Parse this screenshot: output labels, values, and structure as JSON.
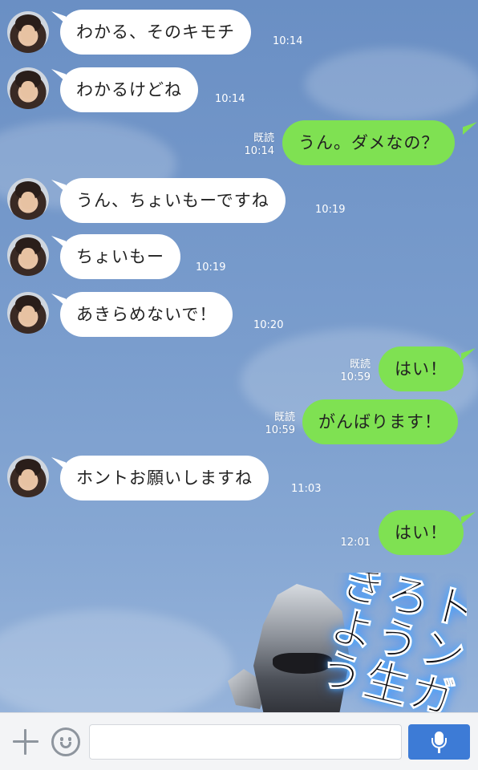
{
  "colors": {
    "background": "#7a9dcd",
    "incoming_bubble": "#ffffff",
    "outgoing_bubble": "#7fe152",
    "send_button": "#3d7bd6"
  },
  "messages": [
    {
      "side": "in",
      "text": "わかる、そのキモチ",
      "time": "10:14"
    },
    {
      "side": "in",
      "text": "わかるけどね",
      "time": "10:14"
    },
    {
      "side": "out",
      "text": "うん。ダメなの？",
      "read": "既読",
      "time": "10:14"
    },
    {
      "side": "in",
      "text": "うん、ちょいもーですね",
      "time": "10:19"
    },
    {
      "side": "in",
      "text": "ちょいもー",
      "time": "10:19"
    },
    {
      "side": "in",
      "text": "あきらめないで！",
      "time": "10:20"
    },
    {
      "side": "out",
      "text": "はい！",
      "read": "既読",
      "time": "10:59"
    },
    {
      "side": "out",
      "text": "がんばります！",
      "read": "既読",
      "time": "10:59"
    },
    {
      "side": "in",
      "text": "ホントお願いしますね",
      "time": "11:03"
    },
    {
      "side": "out",
      "text": "はい！",
      "read": "",
      "time": "12:01"
    }
  ],
  "sticker": {
    "text": "トンガろう生きよう",
    "icon": "armored-hero-sticker"
  },
  "input_bar": {
    "plus_icon": "plus-icon",
    "emoji_icon": "smiley-icon",
    "input_value": "",
    "input_placeholder": "",
    "mic_icon": "microphone-icon"
  }
}
